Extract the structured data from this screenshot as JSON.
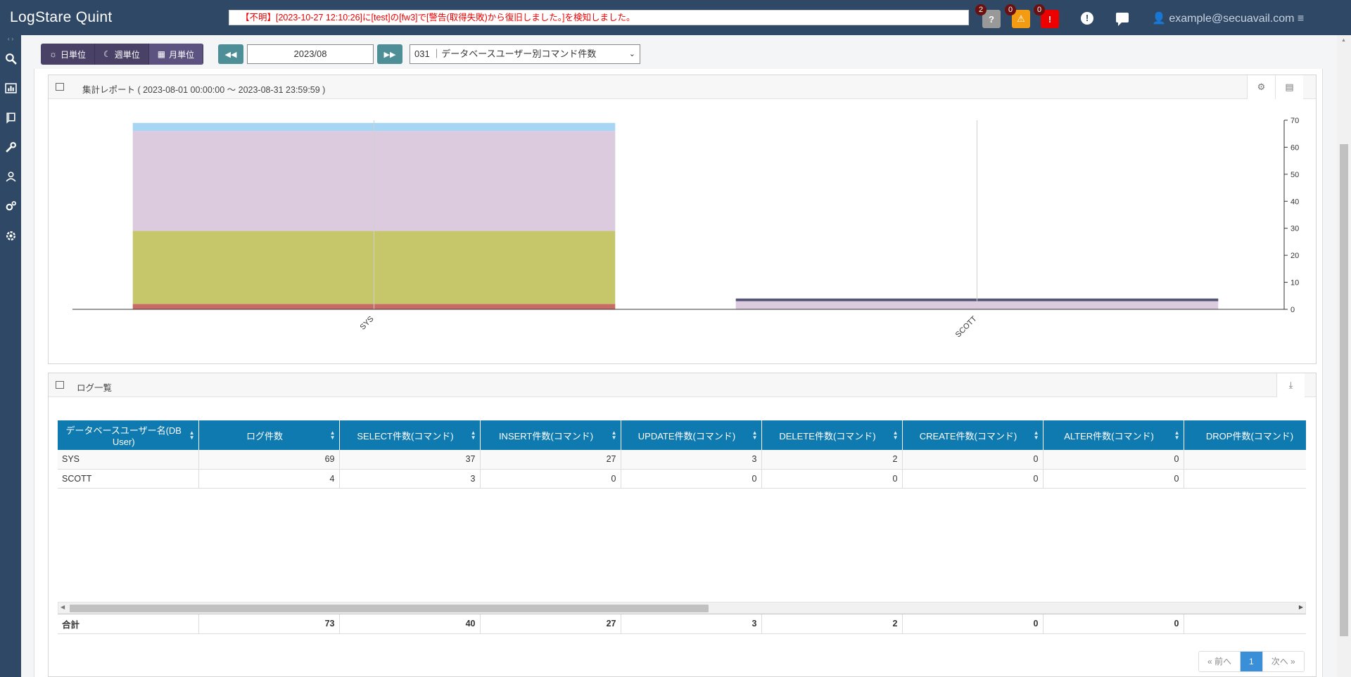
{
  "app": {
    "title": "LogStare Quint"
  },
  "alert": {
    "text": "【不明】[2023-10-27 12:10:26]に[test]の[fw3]で[警告(取得失敗)から復旧しました。]を検知しました。"
  },
  "notifications": [
    {
      "name": "unknown",
      "count": "2",
      "icon": "question-icon",
      "color": "#999999"
    },
    {
      "name": "warning",
      "count": "0",
      "icon": "warning-icon",
      "color": "#f39c12"
    },
    {
      "name": "critical",
      "count": "0",
      "icon": "exclamation-icon",
      "color": "#ee0000"
    }
  ],
  "user": {
    "email": "example@secuavail.com"
  },
  "sidebar": {
    "items": [
      {
        "name": "search",
        "icon": "search-icon"
      },
      {
        "name": "dashboard",
        "icon": "chart-icon"
      },
      {
        "name": "reports",
        "icon": "book-icon"
      },
      {
        "name": "tools",
        "icon": "wrench-icon"
      },
      {
        "name": "users",
        "icon": "users-icon"
      },
      {
        "name": "settings-group",
        "icon": "gears-icon"
      },
      {
        "name": "settings",
        "icon": "gear-icon"
      }
    ]
  },
  "toolbar": {
    "period": [
      "日単位",
      "週単位",
      "月単位"
    ],
    "active_period": "月単位",
    "date_value": "2023/08",
    "report_selected": "031 ｜データベースユーザー別コマンド件数"
  },
  "chart_panel": {
    "title": "集計レポート ( 2023-08-01 00:00:00 ～ 2023-08-31 23:59:59 )"
  },
  "chart_data": {
    "type": "bar",
    "stacked": true,
    "categories": [
      "SYS",
      "SCOTT"
    ],
    "series": [
      {
        "name": "SELECT件数(コマンド)",
        "color": "#c86b64",
        "values": [
          2,
          0
        ]
      },
      {
        "name": "INSERT件数(コマンド)",
        "color": "#c5c76a",
        "values": [
          27,
          0
        ]
      },
      {
        "name": "UPDATE件数(コマンド)",
        "color": "#dccade",
        "values": [
          37,
          3
        ]
      },
      {
        "name": "DELETE件数(コマンド)",
        "color": "#a6d6f4",
        "values": [
          3,
          0
        ]
      },
      {
        "name": "CREATE件数(コマンド)",
        "color": "#555577",
        "values": [
          0,
          1
        ]
      }
    ],
    "ylim": [
      0,
      70
    ],
    "yticks": [
      0,
      10,
      20,
      30,
      40,
      50,
      60,
      70
    ],
    "axis_position": "right"
  },
  "table_panel": {
    "title": "ログ一覧",
    "columns": [
      "データベースユーザー名(DB User)",
      "ログ件数",
      "SELECT件数(コマンド)",
      "INSERT件数(コマンド)",
      "UPDATE件数(コマンド)",
      "DELETE件数(コマンド)",
      "CREATE件数(コマンド)",
      "ALTER件数(コマンド)",
      "DROP件数(コマンド)"
    ],
    "rows": [
      [
        "SYS",
        "69",
        "37",
        "27",
        "3",
        "2",
        "0",
        "0",
        ""
      ],
      [
        "SCOTT",
        "4",
        "3",
        "0",
        "0",
        "0",
        "0",
        "0",
        ""
      ]
    ],
    "totals": [
      "合計",
      "73",
      "40",
      "27",
      "3",
      "2",
      "0",
      "0",
      ""
    ]
  },
  "pager": {
    "prev": "« 前へ",
    "current": "1",
    "next": "次へ »"
  }
}
